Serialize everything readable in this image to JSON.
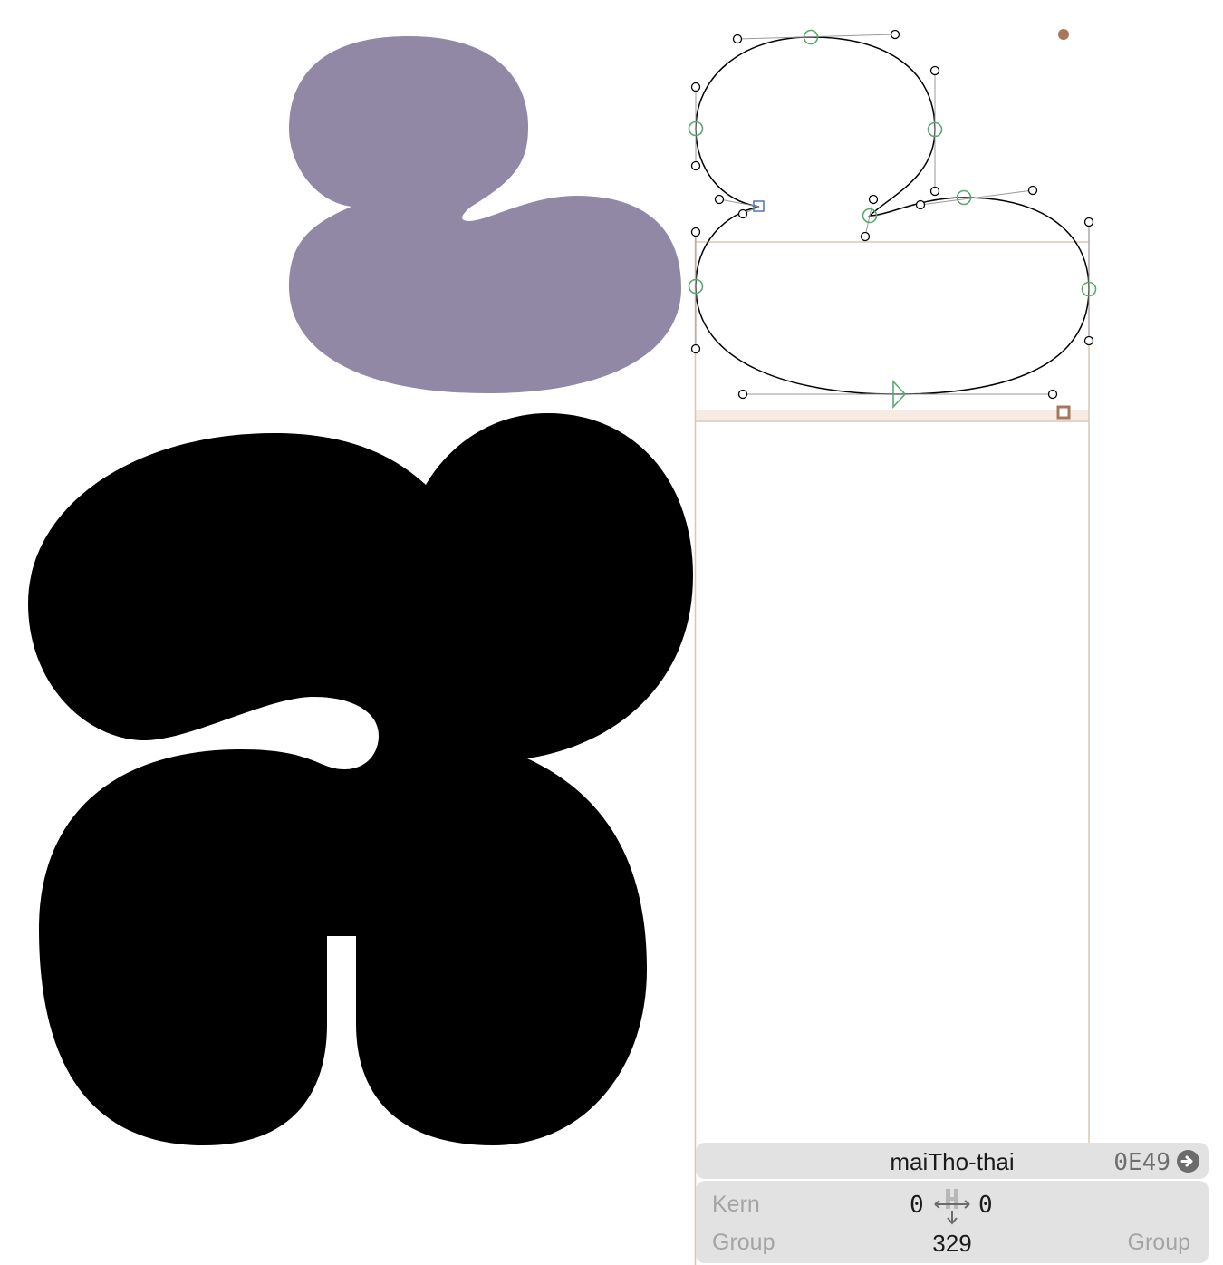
{
  "glyph": {
    "name": "maiTho-thai",
    "unicode": "0E49",
    "fill_color": "#9188a6",
    "outline_color": "#000000",
    "node_color": "#5aa86e",
    "metric_line_color": "#d9c6b4",
    "anchor_color": "#a8775a"
  },
  "base_glyph": {
    "fill_color": "#000000"
  },
  "info_panel": {
    "kern_label": "Kern",
    "kern_left": "0",
    "kern_right": "0",
    "group_label_left": "Group",
    "group_value": "329",
    "group_label_right": "Group",
    "kern_icon": "kerning-arrows-icon",
    "goto_icon": "arrow-right-circle-icon"
  }
}
